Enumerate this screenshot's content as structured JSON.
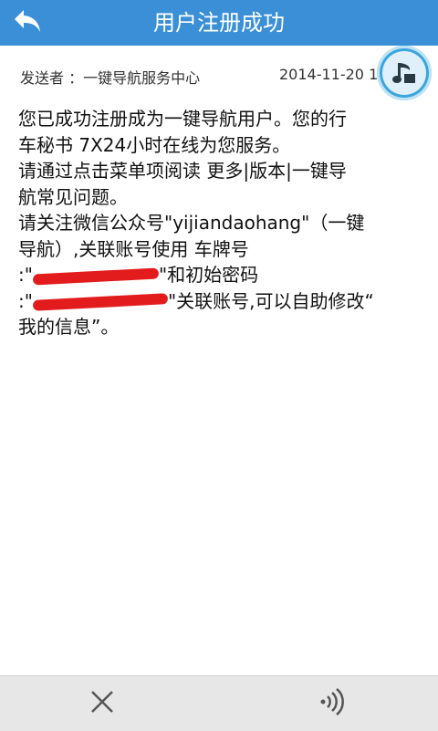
{
  "header": {
    "title": "用户注册成功",
    "back_icon": "back-arrow-icon"
  },
  "meta": {
    "sender": "发送者 ：一键导航服务中心",
    "date": "2014-11-20 10:"
  },
  "content": {
    "line1": "您已成功注册成为一键导航用户。您的行",
    "line2": "车秘书 7X24小时在线为您服务。",
    "line3": "请通过点击菜单项阅读 更多|版本|一键导",
    "line4": "航常见问题。",
    "line5": "请关注微信公众号\"yijiandaohang\"（一键",
    "line6": "导航）,关联账号使用 车牌号",
    "line7a": ":\"",
    "line7b": "\"和初始密码",
    "line8a": ":\"",
    "line8b": "\"关联账号,可以自助修改“",
    "line9": "我的信息”。"
  },
  "bottom_bar": {
    "close_icon": "close-icon",
    "sound_icon": "sound-wave-icon"
  },
  "colors": {
    "header_bg": "#3b8fd6",
    "redaction": "#e21c1c",
    "bottom_bar_bg": "#e7e7e7"
  }
}
